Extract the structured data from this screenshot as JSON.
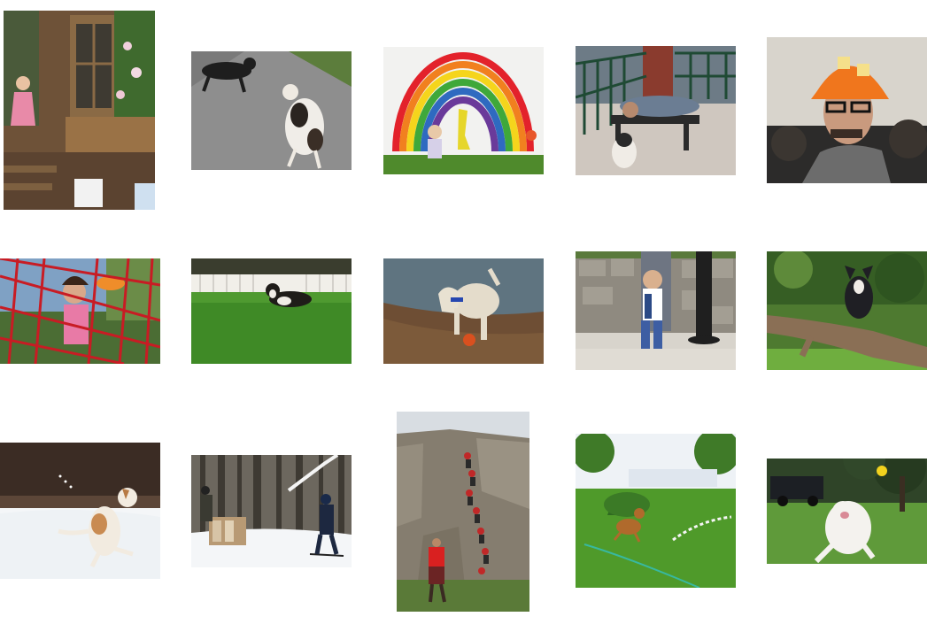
{
  "gallery": {
    "rows": 3,
    "columns": 5,
    "tiles": [
      {
        "subject": "girl-on-wooden-porch"
      },
      {
        "subject": "two-dogs-on-road"
      },
      {
        "subject": "child-under-painted-rainbow"
      },
      {
        "subject": "man-on-bench-with-dog"
      },
      {
        "subject": "man-in-orange-knit-hat"
      },
      {
        "subject": "child-on-red-climbing-net"
      },
      {
        "subject": "dog-running-on-lawn"
      },
      {
        "subject": "dog-with-ball-on-beach"
      },
      {
        "subject": "boy-by-stone-wall"
      },
      {
        "subject": "dog-on-fallen-log"
      },
      {
        "subject": "dog-jumping-in-snow"
      },
      {
        "subject": "skiers-in-snowy-woods"
      },
      {
        "subject": "people-climbing-rock-wall"
      },
      {
        "subject": "dog-by-sprinkler-on-grass"
      },
      {
        "subject": "white-dog-running-in-park"
      }
    ]
  }
}
